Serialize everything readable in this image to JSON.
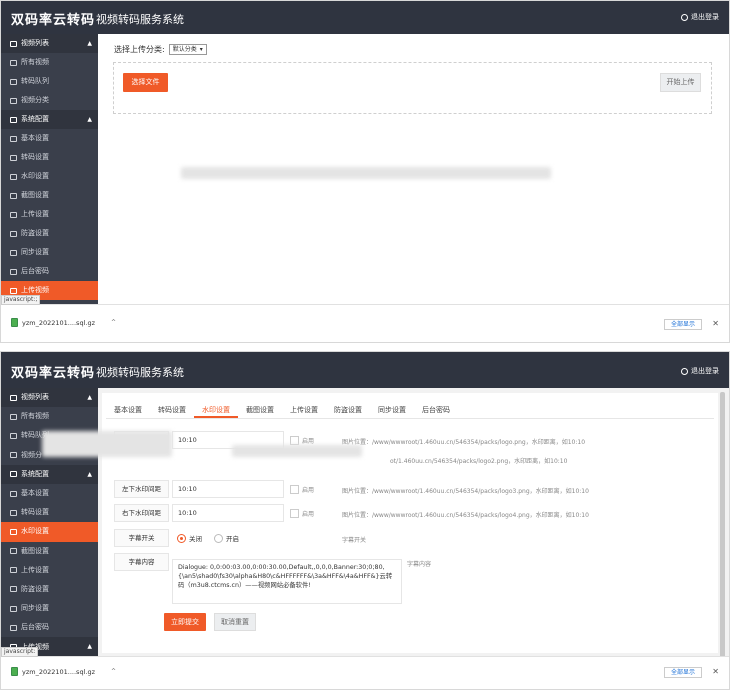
{
  "shot1": {
    "brand": "双码率云转码",
    "system_title": "视频转码服务系统",
    "logout": "退出登录",
    "sidebar": [
      {
        "label": "视频列表",
        "type": "group",
        "icon": "video-icon"
      },
      {
        "label": "所有视频",
        "type": "item",
        "icon": "list-icon"
      },
      {
        "label": "转码队列",
        "type": "item",
        "icon": "queue-icon"
      },
      {
        "label": "视频分类",
        "type": "item",
        "icon": "category-icon"
      },
      {
        "label": "系统配置",
        "type": "group",
        "icon": "gear-icon"
      },
      {
        "label": "基本设置",
        "type": "item",
        "icon": "edit-icon"
      },
      {
        "label": "转码设置",
        "type": "item",
        "icon": "transcode-icon"
      },
      {
        "label": "水印设置",
        "type": "item",
        "icon": "watermark-icon"
      },
      {
        "label": "截图设置",
        "type": "item",
        "icon": "screenshot-icon"
      },
      {
        "label": "上传设置",
        "type": "item",
        "icon": "upload-icon"
      },
      {
        "label": "防盗设置",
        "type": "item",
        "icon": "flag-icon"
      },
      {
        "label": "同步设置",
        "type": "item",
        "icon": "sync-icon"
      },
      {
        "label": "后台密码",
        "type": "item",
        "icon": "lock-icon"
      },
      {
        "label": "上传视频",
        "type": "active",
        "icon": "cloud-upload-icon"
      }
    ],
    "category_label": "选择上传分类:",
    "category_value": "默认分类",
    "choose_file": "选择文件",
    "start_upload": "开始上传",
    "statusbar": {
      "js_tip": "javascript:;",
      "file_name": "yzm_2022101....sql.gz",
      "show_all": "全部显示"
    }
  },
  "shot2": {
    "brand": "双码率云转码",
    "system_title": "视频转码服务系统",
    "logout": "退出登录",
    "sidebar": [
      {
        "label": "视频列表",
        "type": "group",
        "icon": "video-icon"
      },
      {
        "label": "所有视频",
        "type": "item",
        "icon": "list-icon"
      },
      {
        "label": "转码队列",
        "type": "item",
        "icon": "queue-icon"
      },
      {
        "label": "视频分",
        "type": "item",
        "icon": "category-icon"
      },
      {
        "label": "系统配置",
        "type": "group",
        "icon": "gear-icon"
      },
      {
        "label": "基本设置",
        "type": "item",
        "icon": "edit-icon"
      },
      {
        "label": "转码设置",
        "type": "item",
        "icon": "transcode-icon"
      },
      {
        "label": "水印设置",
        "type": "active",
        "icon": "watermark-icon"
      },
      {
        "label": "截图设置",
        "type": "item",
        "icon": "screenshot-icon"
      },
      {
        "label": "上传设置",
        "type": "item",
        "icon": "upload-icon"
      },
      {
        "label": "防盗设置",
        "type": "item",
        "icon": "flag-icon"
      },
      {
        "label": "同步设置",
        "type": "item",
        "icon": "sync-icon"
      },
      {
        "label": "后台密码",
        "type": "item",
        "icon": "lock-icon"
      },
      {
        "label": "上传视频",
        "type": "group",
        "icon": "cloud-upload-icon"
      }
    ],
    "tabs": [
      "基本设置",
      "转码设置",
      "水印设置",
      "截图设置",
      "上传设置",
      "防盗设置",
      "同步设置",
      "后台密码"
    ],
    "active_tab": "水印设置",
    "rows": [
      {
        "label": "左上水印间距",
        "value": "10:10",
        "check": "启用",
        "hint": "图片位置：/www/wwwroot/1.460uu.cn/546354/packs/logo.png，水印距离，如10:10"
      },
      {
        "label": "",
        "value": "",
        "check": "",
        "hint": "ot/1.460uu.cn/546354/packs/logo2.png，水印距离，如10:10"
      },
      {
        "label": "左下水印间距",
        "value": "10:10",
        "check": "启用",
        "hint": "图片位置：/www/wwwroot/1.460uu.cn/546354/packs/logo3.png，水印距离，如10:10"
      },
      {
        "label": "右下水印间距",
        "value": "10:10",
        "check": "启用",
        "hint": "图片位置：/www/wwwroot/1.460uu.cn/546354/packs/logo4.png，水印距离，如10:10"
      }
    ],
    "subtitle_switch_label": "字幕开关",
    "radio_off": "关闭",
    "radio_on": "开启",
    "subtitle_switch_hint": "字幕开关",
    "subtitle_content_label": "字幕内容",
    "subtitle_content": "Dialogue: 0,0:00:03.00,0:00:30.00,Default,,0,0,0,Banner:30;0;80,{\\an5\\shad0\\fs30\\alpha&H80\\c&HFFFFFF&\\3a&HFF&\\4a&HFF&}云转码（m3u8.ctcms.cn）——视频网站必备软件!",
    "subtitle_content_hint": "字幕内容",
    "submit": "立即提交",
    "reset": "取消重置",
    "statusbar": {
      "js_tip": "javascript:",
      "file_name": "yzm_2022101....sql.gz",
      "show_all": "全部显示"
    }
  }
}
